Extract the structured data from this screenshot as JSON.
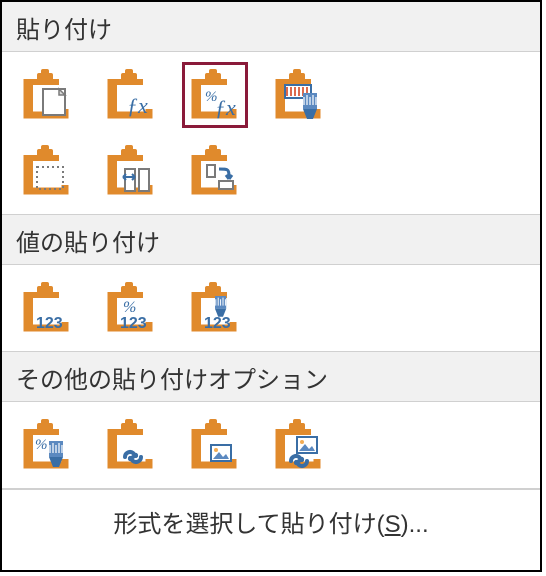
{
  "sections": {
    "paste": {
      "title": "貼り付け"
    },
    "values": {
      "title": "値の貼り付け"
    },
    "other": {
      "title": "その他の貼り付けオプション"
    }
  },
  "footer": {
    "prefix": "形式を選択して貼り付け(",
    "hotkey": "S",
    "suffix": ")..."
  },
  "icons": {
    "paste": "paste",
    "paste_formulas": "paste-formulas",
    "paste_formulas_number_formatting": "paste-formulas-number-formatting",
    "paste_keep_formatting": "paste-keep-source-formatting",
    "paste_no_borders": "paste-no-borders",
    "paste_keep_column_widths": "paste-keep-source-column-widths",
    "paste_transpose": "paste-transpose",
    "values": "paste-values",
    "values_number_formatting": "paste-values-number-formatting",
    "values_source_formatting": "paste-values-source-formatting",
    "formatting": "paste-formatting",
    "paste_link": "paste-link",
    "picture": "paste-picture",
    "linked_picture": "paste-linked-picture"
  },
  "labels": {
    "num": "123"
  },
  "colors": {
    "clip": "#e08a2c",
    "clip_light": "#f3ad55",
    "accent": "#3a6ea5",
    "accent2": "#5b89c0",
    "gray": "#7a7a7a",
    "highlight": "#8a1a3a"
  }
}
